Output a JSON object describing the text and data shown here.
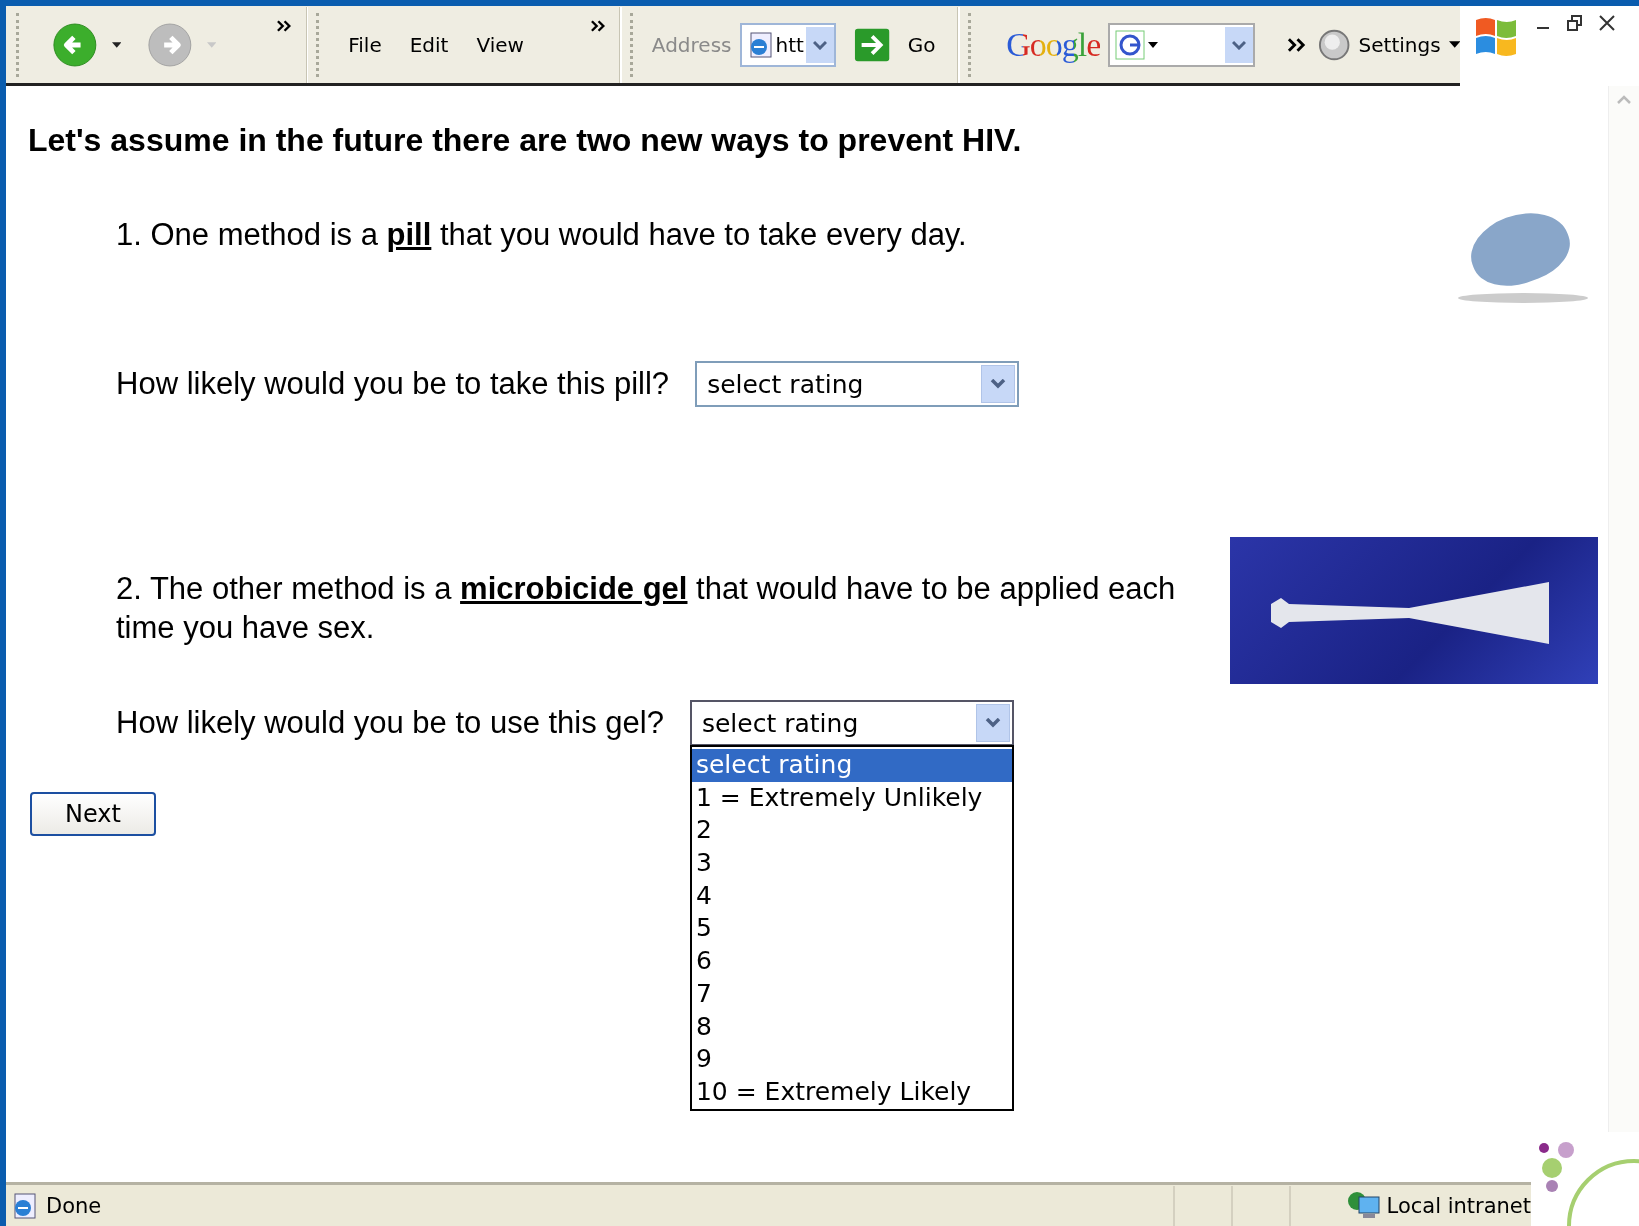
{
  "toolbar": {
    "menu": [
      "File",
      "Edit",
      "View"
    ],
    "address_label": "Address",
    "address_value": "htt",
    "go": "Go",
    "google": "Google",
    "settings": "Settings"
  },
  "page": {
    "heading": "Let's assume in the future there are two new ways to prevent HIV.",
    "questions": [
      {
        "text": "1. One method is a **pill** that you would have to take every day.",
        "kind": "pill",
        "prompt": "How likely would you be to take this pill?",
        "select": {
          "value": "select rating",
          "expanded": false
        }
      },
      {
        "text": "2. The other method is a **microbicide gel** that would have to be applied each time you have sex.",
        "kind": "gel",
        "prompt": "How likely would you be to use this gel?",
        "select": {
          "value": "select rating",
          "expanded": true
        }
      }
    ],
    "options": [
      {
        "label": "select rating",
        "selected": true
      },
      {
        "label": "1 = Extremely Unlikely",
        "selected": false
      },
      {
        "label": "2",
        "selected": false
      },
      {
        "label": "3",
        "selected": false
      },
      {
        "label": "4",
        "selected": false
      },
      {
        "label": "5",
        "selected": false
      },
      {
        "label": "6",
        "selected": false
      },
      {
        "label": "7",
        "selected": false
      },
      {
        "label": "8",
        "selected": false
      },
      {
        "label": "9",
        "selected": false
      },
      {
        "label": "10 = Extremely Likely",
        "selected": false
      }
    ],
    "next": "Next"
  },
  "status_bar": {
    "status": "Done",
    "zone": "Local intranet"
  }
}
